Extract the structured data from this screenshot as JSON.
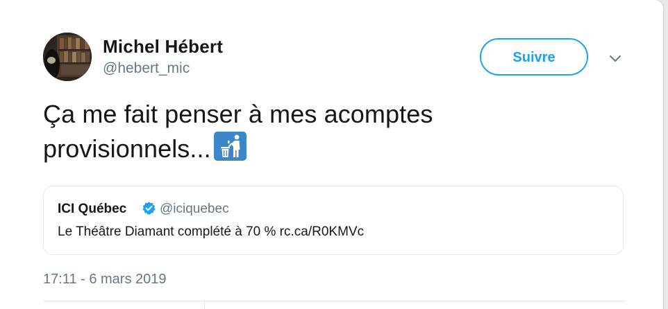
{
  "author": {
    "display_name": "Michel Hébert",
    "handle": "@hebert_mic"
  },
  "follow_button": {
    "label": "Suivre"
  },
  "tweet": {
    "text_line1": "Ça me fait penser à mes acomptes",
    "text_line2": "provisionnels...",
    "emoji": "put-litter-in-its-place-icon",
    "timestamp": "17:11 - 6 mars 2019"
  },
  "quoted_tweet": {
    "display_name": "ICI Québec",
    "handle": "@iciquebec",
    "text": "Le Théâtre Diamant complété à 70 % rc.ca/R0KMVc",
    "verified": true
  },
  "colors": {
    "accent": "#1da1f2",
    "text_primary": "#14171a",
    "text_secondary": "#657786",
    "border": "#e1e8ed",
    "emoji_bg": "#3b87c9"
  }
}
